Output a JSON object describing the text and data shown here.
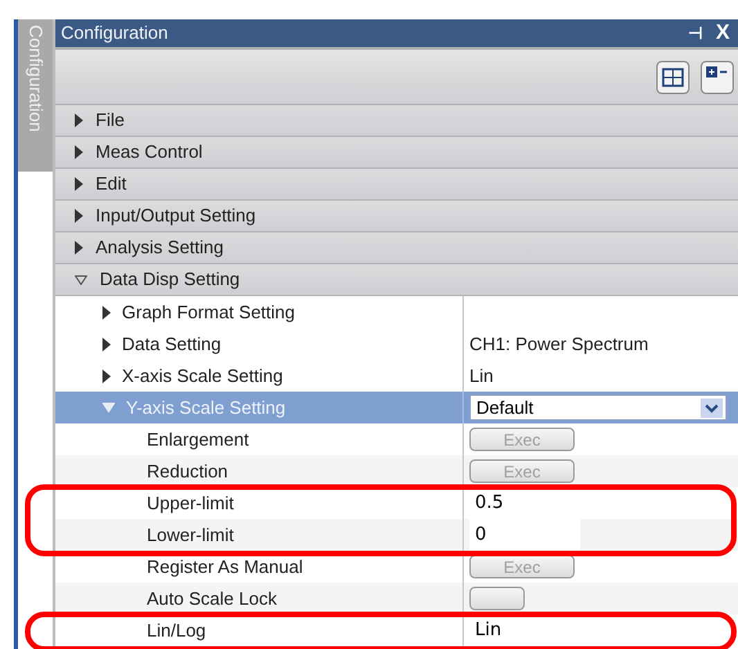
{
  "side_tab": {
    "label": "Configuration"
  },
  "window": {
    "title": "Configuration",
    "pin": "⊣",
    "close": "X"
  },
  "categories": [
    {
      "label": "File",
      "expanded": false
    },
    {
      "label": "Meas Control",
      "expanded": false
    },
    {
      "label": "Edit",
      "expanded": false
    },
    {
      "label": "Input/Output Setting",
      "expanded": false
    },
    {
      "label": "Analysis Setting",
      "expanded": false
    },
    {
      "label": "Data Disp Setting",
      "expanded": true,
      "children": [
        {
          "label": "Graph Format Setting",
          "kind": "group",
          "expanded": false,
          "selected": false
        },
        {
          "label": "Data Setting",
          "kind": "group",
          "expanded": false,
          "selected": false,
          "value": "CH1: Power Spectrum"
        },
        {
          "label": "X-axis Scale Setting",
          "kind": "group",
          "expanded": false,
          "selected": false,
          "value": "Lin"
        },
        {
          "label": "Y-axis Scale Setting",
          "kind": "dropdown",
          "expanded": true,
          "selected": true,
          "value": "Default",
          "children": [
            {
              "label": "Enlargement",
              "kind": "button",
              "button": "Exec",
              "disabled": true
            },
            {
              "label": "Reduction",
              "kind": "button",
              "button": "Exec",
              "disabled": true
            },
            {
              "label": "Upper-limit",
              "kind": "field",
              "value": "0.5",
              "highlighted": true
            },
            {
              "label": "Lower-limit",
              "kind": "field",
              "value": "0",
              "highlighted": true
            },
            {
              "label": "Register As Manual",
              "kind": "button",
              "button": "Exec",
              "disabled": true
            },
            {
              "label": "Auto Scale Lock",
              "kind": "toggle",
              "on": false
            },
            {
              "label": "Lin/Log",
              "kind": "field",
              "value": "Lin",
              "highlighted": true
            }
          ]
        }
      ]
    }
  ]
}
